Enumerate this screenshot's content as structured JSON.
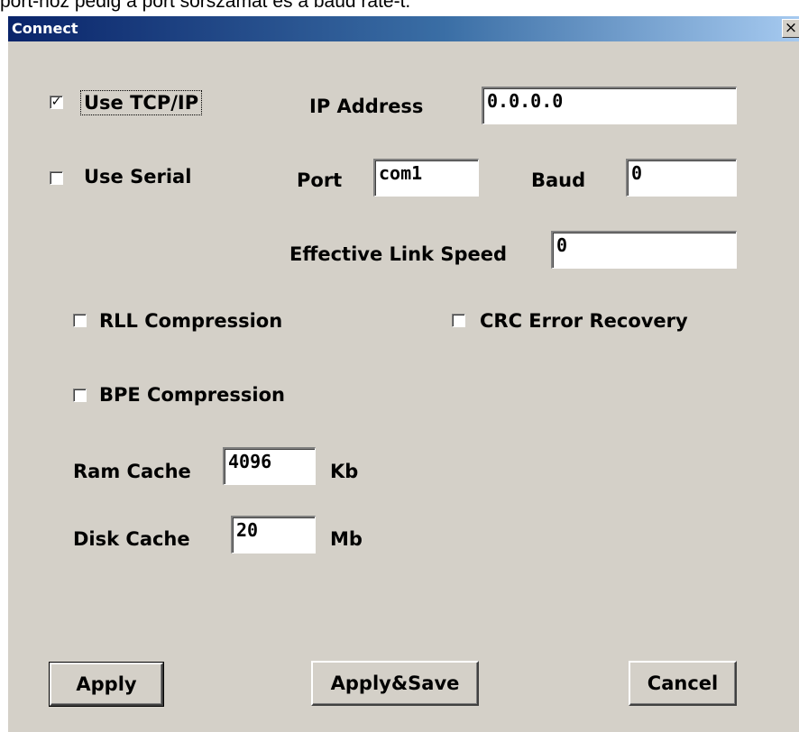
{
  "doc_snippet": "port-hoz pedig a port sorszámát és a baud rate-t.",
  "window": {
    "title": "Connect",
    "close_glyph": "×"
  },
  "connection": {
    "use_tcpip": {
      "label": "Use TCP/IP",
      "checked": true,
      "mark": "✓"
    },
    "use_serial": {
      "label": "Use Serial",
      "checked": false,
      "mark": ""
    },
    "ip_address": {
      "label": "IP Address",
      "value": "0.0.0.0"
    },
    "port": {
      "label": "Port",
      "value": "com1"
    },
    "baud": {
      "label": "Baud",
      "value": "0"
    },
    "link_speed": {
      "label": "Effective Link Speed",
      "value": "0"
    }
  },
  "options": {
    "rll": {
      "label": "RLL Compression",
      "checked": false,
      "mark": ""
    },
    "crc": {
      "label": "CRC Error Recovery",
      "checked": false,
      "mark": ""
    },
    "bpe": {
      "label": "BPE Compression",
      "checked": false,
      "mark": ""
    }
  },
  "cache": {
    "ram": {
      "label": "Ram Cache",
      "value": "4096",
      "unit": "Kb"
    },
    "disk": {
      "label": "Disk Cache",
      "value": "20",
      "unit": "Mb"
    }
  },
  "buttons": {
    "apply": "Apply",
    "apply_save": "Apply&Save",
    "cancel": "Cancel"
  }
}
